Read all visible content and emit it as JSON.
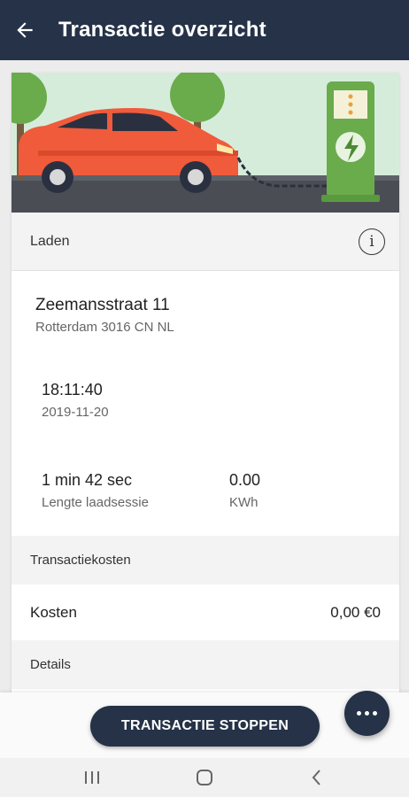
{
  "appbar": {
    "title": "Transactie overzicht",
    "back_icon": "arrow-left-icon"
  },
  "hero": {
    "image": "car-charging-illustration",
    "colors": {
      "sky": "#d4ead9",
      "car": "#ef5b3b",
      "charger": "#6aaa4b",
      "tree": "#6aaa4b"
    }
  },
  "charging": {
    "header": "Laden",
    "info_icon": "info-icon",
    "address": {
      "street": "Zeemansstraat 11",
      "city": "Rotterdam 3016 CN NL"
    },
    "time": "18:11:40",
    "date": "2019-11-20",
    "duration": {
      "value": "1 min 42 sec",
      "label": "Lengte laadsessie"
    },
    "energy": {
      "value": "0.00",
      "label": "KWh"
    }
  },
  "costs": {
    "header": "Transactiekosten",
    "row_label": "Kosten",
    "row_value": "0,00 €0"
  },
  "details": {
    "header": "Details"
  },
  "actions": {
    "stop_label": "TRANSACTIE STOPPEN",
    "more_icon": "more-horizontal-icon"
  },
  "navigation": {
    "recent_icon": "recent-apps-icon",
    "home_icon": "home-icon",
    "back_icon": "back-chevron-icon"
  },
  "colors": {
    "primary": "#253247",
    "background": "#ececec",
    "section": "#f3f3f3"
  }
}
